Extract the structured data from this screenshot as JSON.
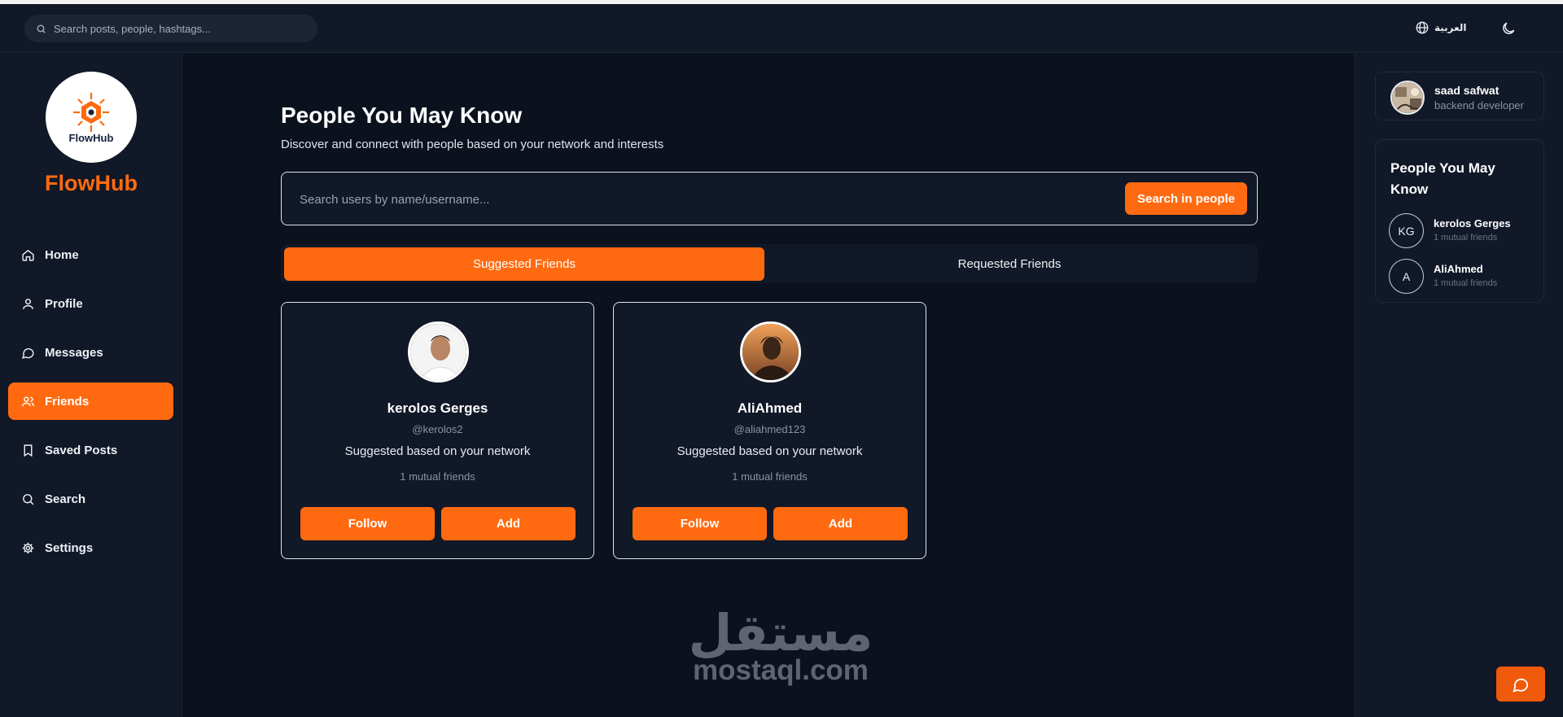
{
  "topbar": {
    "search_placeholder": "Search posts, people, hashtags...",
    "language_label": "العربية"
  },
  "sidebar": {
    "logo_text": "FlowHub",
    "brand": "FlowHub",
    "items": [
      {
        "label": "Home",
        "icon": "home-icon"
      },
      {
        "label": "Profile",
        "icon": "user-icon"
      },
      {
        "label": "Messages",
        "icon": "message-icon"
      },
      {
        "label": "Friends",
        "icon": "users-icon",
        "active": true
      },
      {
        "label": "Saved Posts",
        "icon": "bookmark-icon"
      },
      {
        "label": "Search",
        "icon": "search-icon"
      },
      {
        "label": "Settings",
        "icon": "gear-icon"
      }
    ]
  },
  "main": {
    "title": "People You May Know",
    "subtitle": "Discover and connect with people based on your network and interests",
    "search_placeholder": "Search users by name/username...",
    "search_button": "Search in people",
    "tabs": [
      "Suggested Friends",
      "Requested Friends"
    ],
    "cards": [
      {
        "name": "kerolos Gerges",
        "handle": "@kerolos2",
        "reason": "Suggested based on your network",
        "mutual": "1 mutual friends",
        "follow": "Follow",
        "add": "Add"
      },
      {
        "name": "AliAhmed",
        "handle": "@aliahmed123",
        "reason": "Suggested based on your network",
        "mutual": "1 mutual friends",
        "follow": "Follow",
        "add": "Add"
      }
    ]
  },
  "watermark": {
    "arabic": "مستقل",
    "latin": "mostaql.com"
  },
  "rightbar": {
    "me": {
      "name": "saad safwat",
      "role": "backend developer"
    },
    "pymk_title": "People You May Know",
    "people": [
      {
        "initials": "KG",
        "name": "kerolos Gerges",
        "mutual": "1 mutual friends"
      },
      {
        "initials": "A",
        "name": "AliAhmed",
        "mutual": "1 mutual friends"
      }
    ]
  },
  "colors": {
    "accent": "#ff6a10",
    "background": "#0b111d",
    "panel": "#111827"
  }
}
